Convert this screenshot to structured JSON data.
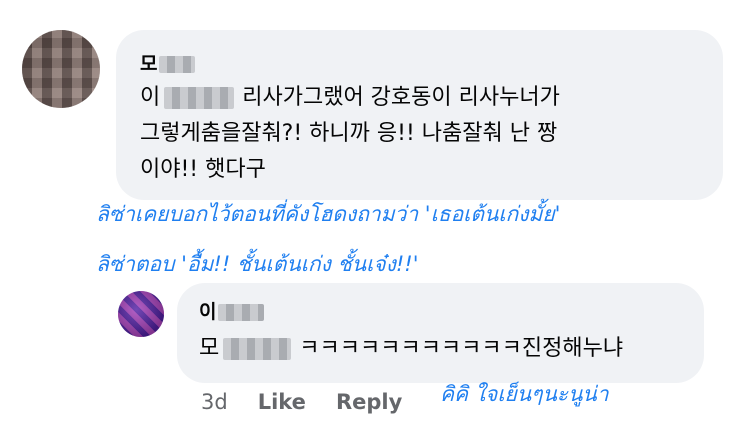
{
  "comment": {
    "author_prefix": "모",
    "line1_prefix": "이",
    "line1_rest": "리사가그랬어 강호동이 리사누너가",
    "line2": "그렇게춤을잘춰?! 하니까 응!! 나춤잘춰 난 짱",
    "line3": "이야!! 햇다구"
  },
  "reply": {
    "author_prefix": "이",
    "text_prefix": "모",
    "text_rest": "ㅋㅋㅋㅋㅋㅋㅋㅋㅋㅋㅋ진정해누냐"
  },
  "overlay": {
    "line1": "ลิซ่าเคยบอกไว้ตอนที่คังโฮดงถามว่า 'เธอเต้นเก่งมั้ย'",
    "line2": "ลิซ่าตอบ 'อื้ม!! ชั้นเต้นเก่ง ชั้นเจ๋ง!!'",
    "line3": "คิคิ ใจเย็นๆนะนูน่า"
  },
  "actions": {
    "time": "3d",
    "like": "Like",
    "reply": "Reply"
  },
  "colors": {
    "bubble": "#f0f2f5",
    "overlay_text": "#1f7ff0",
    "meta_text": "#65676b"
  }
}
